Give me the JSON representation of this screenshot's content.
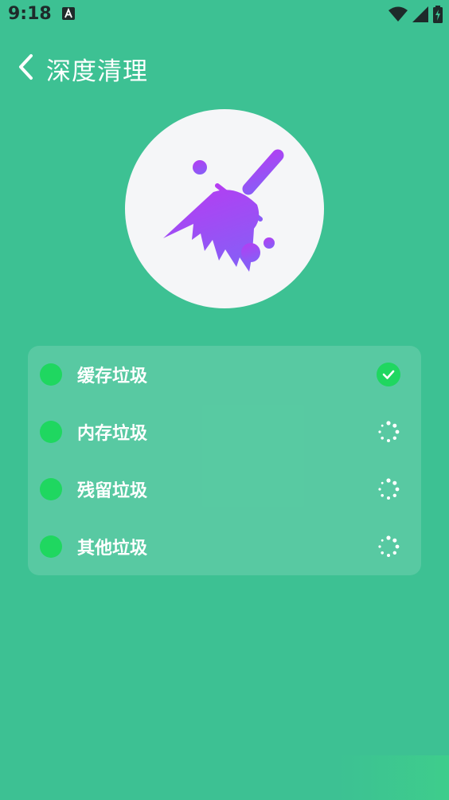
{
  "status_bar": {
    "time": "9:18",
    "icons": [
      "a-notification-icon",
      "wifi-icon",
      "signal-icon",
      "battery-charging-icon"
    ]
  },
  "header": {
    "title": "深度清理",
    "back_icon": "chevron-left-icon"
  },
  "logo": {
    "icon": "broom-icon",
    "colors": {
      "top": "#b63cf2",
      "bottom": "#8a5cf6",
      "background": "#f5f6f8"
    }
  },
  "junk_list": [
    {
      "label": "缓存垃圾",
      "status": "done"
    },
    {
      "label": "内存垃圾",
      "status": "scanning"
    },
    {
      "label": "残留垃圾",
      "status": "scanning"
    },
    {
      "label": "其他垃圾",
      "status": "scanning"
    }
  ],
  "colors": {
    "background": "#3dc193",
    "accent_green": "#1fd760",
    "text": "#ffffff"
  }
}
